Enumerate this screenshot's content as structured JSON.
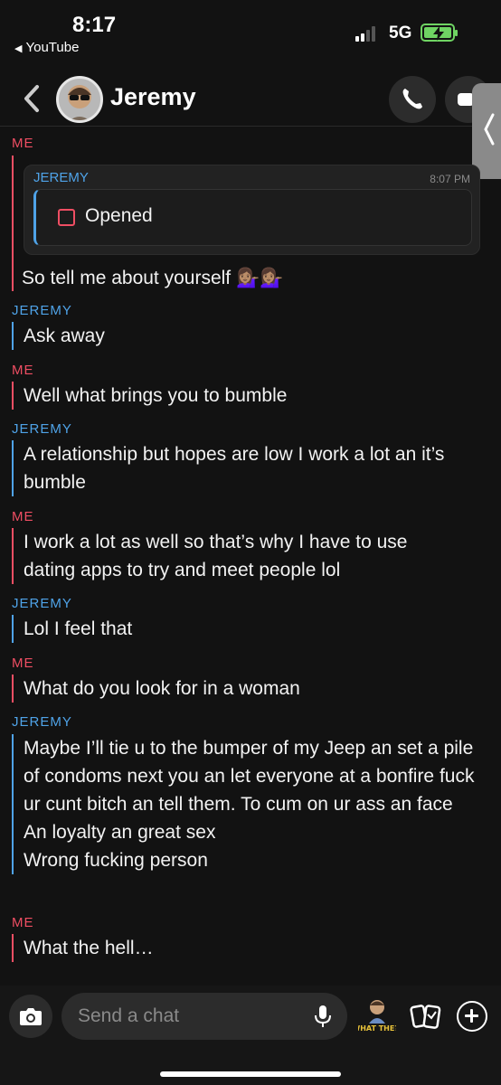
{
  "status_bar": {
    "time": "8:17",
    "back_app": "YouTube",
    "network": "5G"
  },
  "header": {
    "contact_name": "Jeremy"
  },
  "quote": {
    "sender": "JEREMY",
    "time": "8:07 PM",
    "text": "Opened"
  },
  "messages": [
    {
      "sender": "ME",
      "text": "So tell me about yourself 💁🏽‍♀️💁🏽‍♀️"
    },
    {
      "sender": "JEREMY",
      "text": "Ask away"
    },
    {
      "sender": "ME",
      "text": "Well what brings you to bumble"
    },
    {
      "sender": "JEREMY",
      "text": "A relationship but hopes are low I work a lot an it’s bumble"
    },
    {
      "sender": "ME",
      "text": "I work a lot as well so that’s why I have to use dating apps to try and meet people lol"
    },
    {
      "sender": "JEREMY",
      "text": "Lol I feel that"
    },
    {
      "sender": "ME",
      "text": "What do you look for in a woman"
    },
    {
      "sender": "JEREMY",
      "text": "Maybe I’ll tie u to the bumper of my Jeep an set a pile of condoms next you an let everyone at a bonfire fuck ur cunt bitch an tell them. To cum on ur ass an face\nAn loyalty an great sex\nWrong fucking person"
    },
    {
      "sender": "ME",
      "text": "What the hell…"
    }
  ],
  "input": {
    "placeholder": "Send a chat"
  },
  "bitmoji_caption": "WHAT THE?!",
  "colors": {
    "me": "#ef4e63",
    "jeremy": "#4fa3e8",
    "background": "#121212"
  }
}
